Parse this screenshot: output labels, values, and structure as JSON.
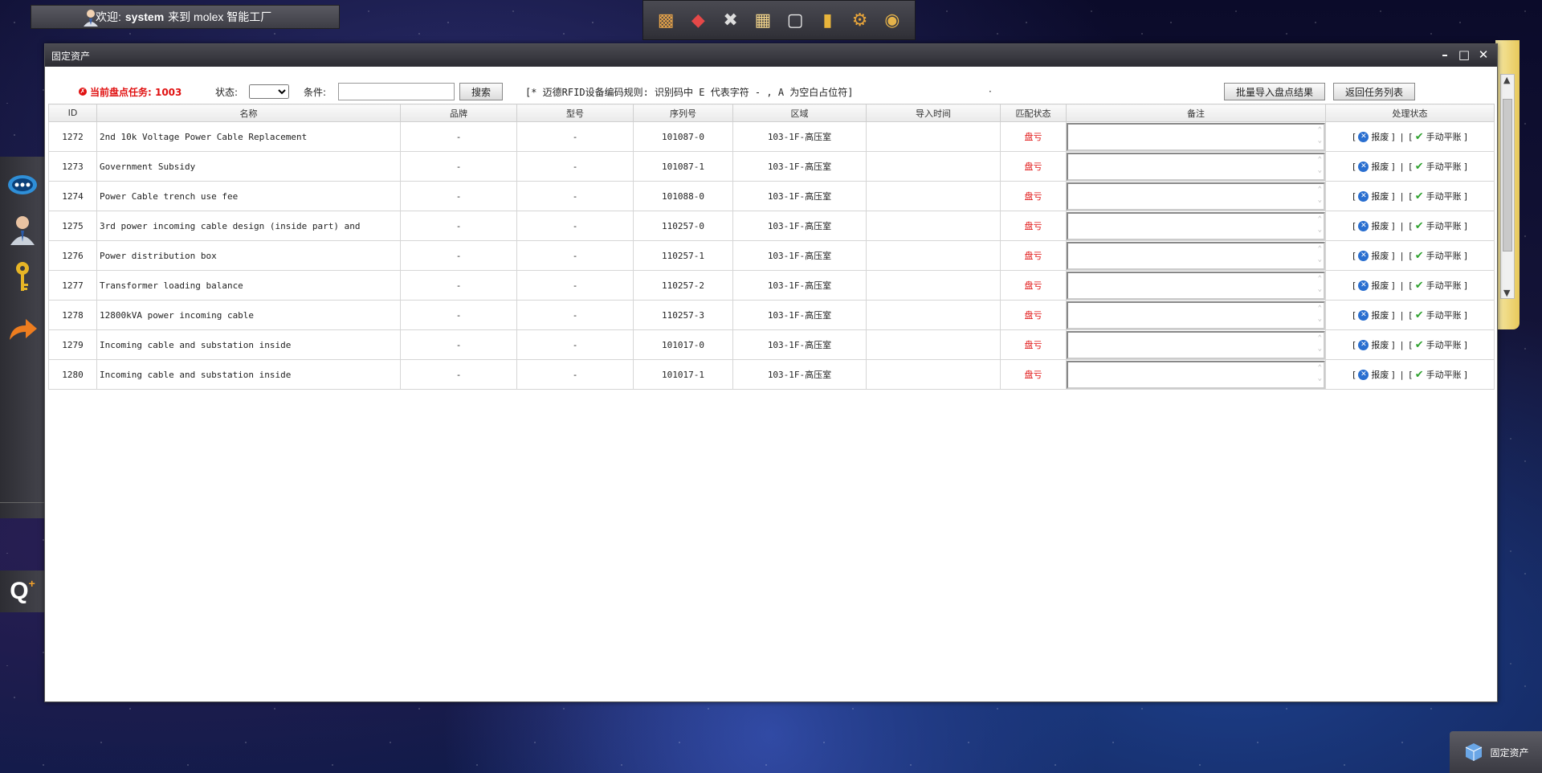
{
  "topbar": {
    "welcome_prefix": "欢迎:",
    "user": "system",
    "welcome_suffix": "来到 molex 智能工厂"
  },
  "window": {
    "title": "固定资产"
  },
  "filters": {
    "task_label": "当前盘点任务: 1003",
    "status_label": "状态:",
    "status_value": "",
    "condition_label": "条件:",
    "condition_value": "",
    "search_button": "搜索",
    "rule_note": "[* 迈德RFID设备编码规则: 识别码中 E 代表字符 - , A 为空白占位符]",
    "import_button": "批量导入盘点结果",
    "back_button": "返回任务列表"
  },
  "table": {
    "headers": [
      "ID",
      "名称",
      "品牌",
      "型号",
      "序列号",
      "区域",
      "导入时间",
      "匹配状态",
      "备注",
      "处理状态"
    ],
    "rows": [
      {
        "id": "1272",
        "name": "2nd 10k Voltage Power Cable Replacement",
        "brand": "-",
        "model": "-",
        "serial": "101087-0",
        "area": "103-1F-高压室",
        "import_time": "",
        "match": "盘亏",
        "remark": ""
      },
      {
        "id": "1273",
        "name": "Government Subsidy",
        "brand": "-",
        "model": "-",
        "serial": "101087-1",
        "area": "103-1F-高压室",
        "import_time": "",
        "match": "盘亏",
        "remark": ""
      },
      {
        "id": "1274",
        "name": "Power Cable trench use fee",
        "brand": "-",
        "model": "-",
        "serial": "101088-0",
        "area": "103-1F-高压室",
        "import_time": "",
        "match": "盘亏",
        "remark": ""
      },
      {
        "id": "1275",
        "name": "3rd power incoming cable design (inside part) and",
        "brand": "-",
        "model": "-",
        "serial": "110257-0",
        "area": "103-1F-高压室",
        "import_time": "",
        "match": "盘亏",
        "remark": ""
      },
      {
        "id": "1276",
        "name": "Power distribution box",
        "brand": "-",
        "model": "-",
        "serial": "110257-1",
        "area": "103-1F-高压室",
        "import_time": "",
        "match": "盘亏",
        "remark": ""
      },
      {
        "id": "1277",
        "name": "Transformer loading balance",
        "brand": "-",
        "model": "-",
        "serial": "110257-2",
        "area": "103-1F-高压室",
        "import_time": "",
        "match": "盘亏",
        "remark": ""
      },
      {
        "id": "1278",
        "name": "12800kVA power incoming cable",
        "brand": "-",
        "model": "-",
        "serial": "110257-3",
        "area": "103-1F-高压室",
        "import_time": "",
        "match": "盘亏",
        "remark": ""
      },
      {
        "id": "1279",
        "name": "Incoming cable and substation inside",
        "brand": "-",
        "model": "-",
        "serial": "101017-0",
        "area": "103-1F-高压室",
        "import_time": "",
        "match": "盘亏",
        "remark": ""
      },
      {
        "id": "1280",
        "name": "Incoming cable and substation inside",
        "brand": "-",
        "model": "-",
        "serial": "101017-1",
        "area": "103-1F-高压室",
        "import_time": "",
        "match": "盘亏",
        "remark": ""
      }
    ],
    "actions": {
      "scrap": "报废",
      "balance": "手动平账",
      "separator": "|"
    }
  },
  "taskbar": {
    "item_label": "固定资产"
  },
  "colors": {
    "alert": "#e01010",
    "accent_blue": "#2a6fd0",
    "ok_green": "#2fa12f"
  }
}
